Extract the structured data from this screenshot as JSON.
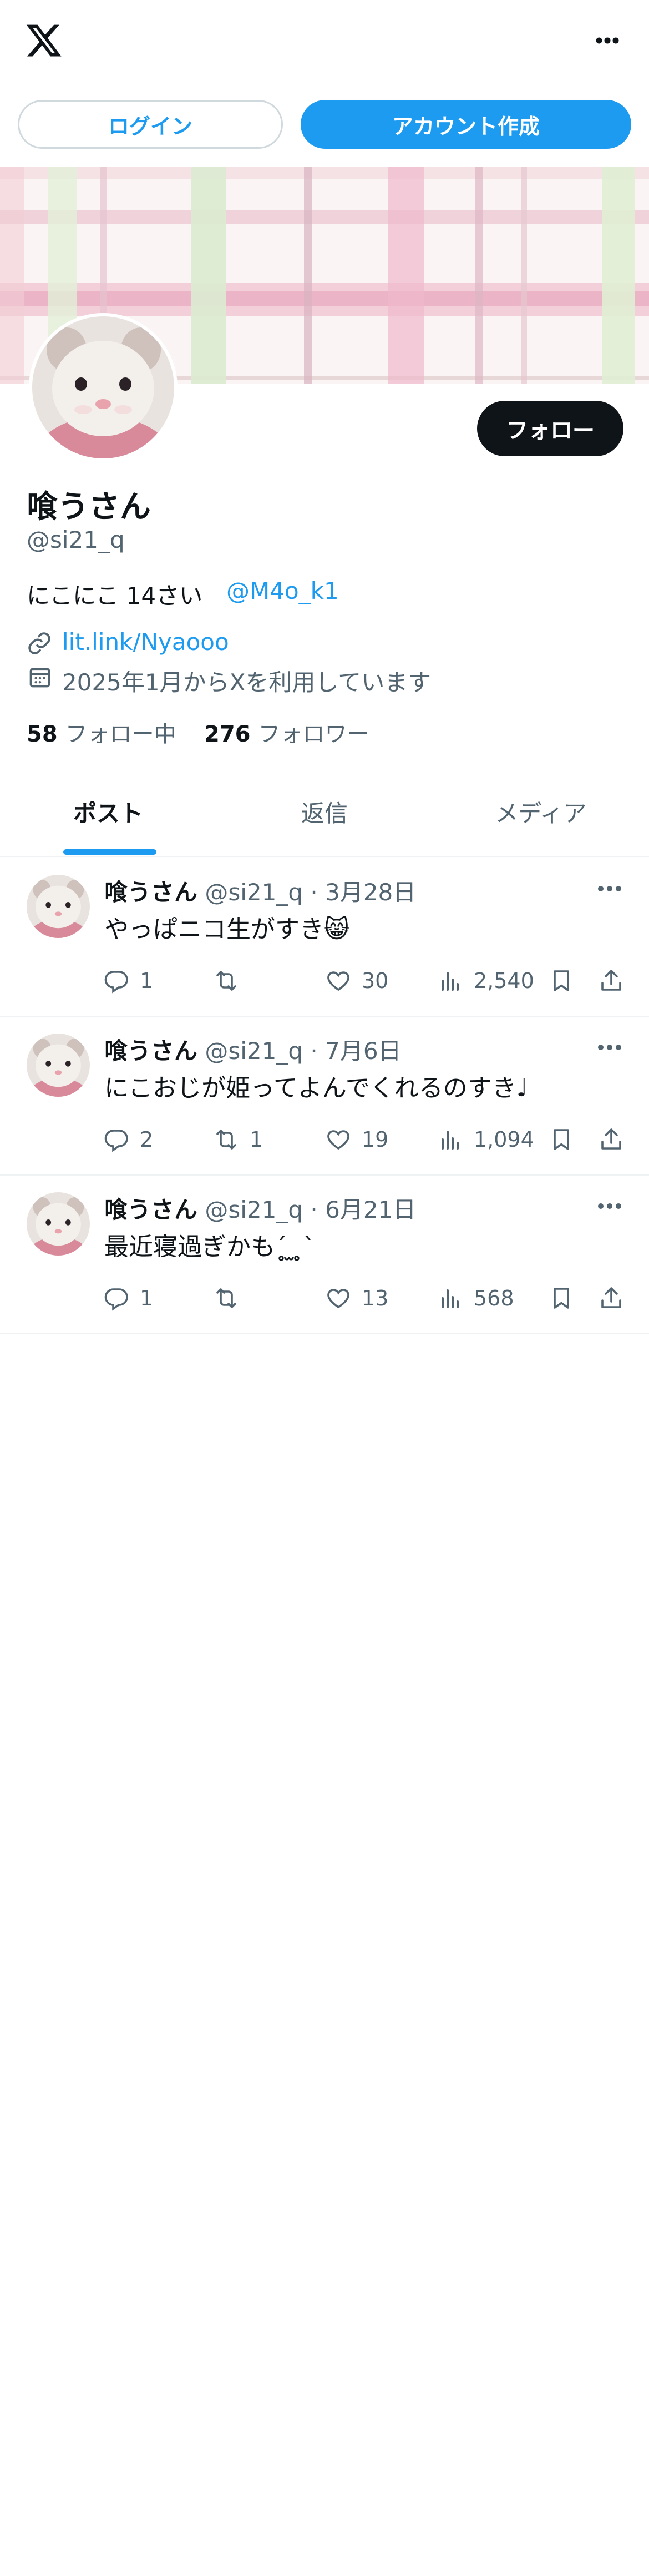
{
  "header": {
    "logo_icon": "x-logo-icon",
    "more_icon": "more-horizontal-icon",
    "login_label": "ログイン",
    "signup_label": "アカウント作成"
  },
  "profile": {
    "display_name": "喰うさん",
    "handle": "@si21_q",
    "follow_label": "フォロー",
    "bio": "にこにこ 14さい",
    "bio_mention": "@M4o_k1",
    "website": "lit.link/Nyaooo",
    "joined": "2025年1月からXを利用しています",
    "following_count": "58",
    "following_label": "フォロー中",
    "followers_count": "276",
    "followers_label": "フォロワー"
  },
  "tabs": [
    {
      "label": "ポスト",
      "active": true
    },
    {
      "label": "返信",
      "active": false
    },
    {
      "label": "メディア",
      "active": false
    }
  ],
  "posts": [
    {
      "name": "喰うさん",
      "handle": "@si21_q",
      "date": "3月28日",
      "text": "やっぱニコ生がすき😸",
      "replies": "1",
      "reposts": "",
      "likes": "30",
      "views": "2,540"
    },
    {
      "name": "喰うさん",
      "handle": "@si21_q",
      "date": "7月6日",
      "text": "にこおじが姫ってよんでくれるのすき♩",
      "replies": "2",
      "reposts": "1",
      "likes": "19",
      "views": "1,094"
    },
    {
      "name": "喰うさん",
      "handle": "@si21_q",
      "date": "6月21日",
      "text": "最近寝過ぎかも´̥̥̥ ̫ ̥̥̥`",
      "replies": "1",
      "reposts": "",
      "likes": "13",
      "views": "568"
    }
  ],
  "colors": {
    "accent": "#1d9bf0",
    "text": "#0f1419",
    "secondary": "#536471",
    "divider": "#eff3f4"
  }
}
